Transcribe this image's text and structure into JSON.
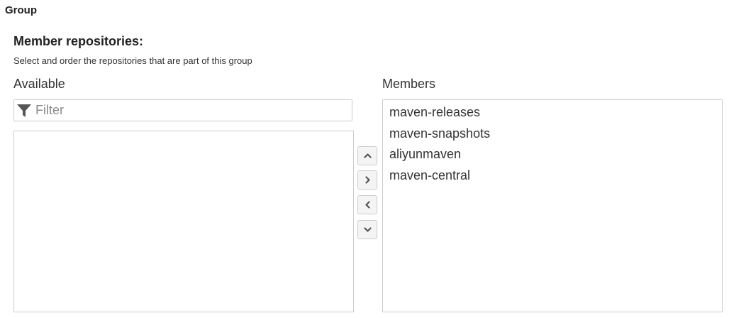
{
  "section": {
    "title": "Group"
  },
  "field": {
    "label": "Member repositories:",
    "help": "Select and order the repositories that are part of this group"
  },
  "available": {
    "label": "Available",
    "filter_placeholder": "Filter",
    "filter_icon": "filter-funnel-icon",
    "items": []
  },
  "members": {
    "label": "Members",
    "items": [
      "maven-releases",
      "maven-snapshots",
      "aliyunmaven",
      "maven-central"
    ]
  },
  "buttons": {
    "move_up_icon": "chevron-up-icon",
    "add_icon": "chevron-right-icon",
    "remove_icon": "chevron-left-icon",
    "move_down_icon": "chevron-down-icon"
  },
  "colors": {
    "border": "#cccccc",
    "button_bg": "#f4f4f4",
    "text": "#333333",
    "icon": "#555555"
  }
}
